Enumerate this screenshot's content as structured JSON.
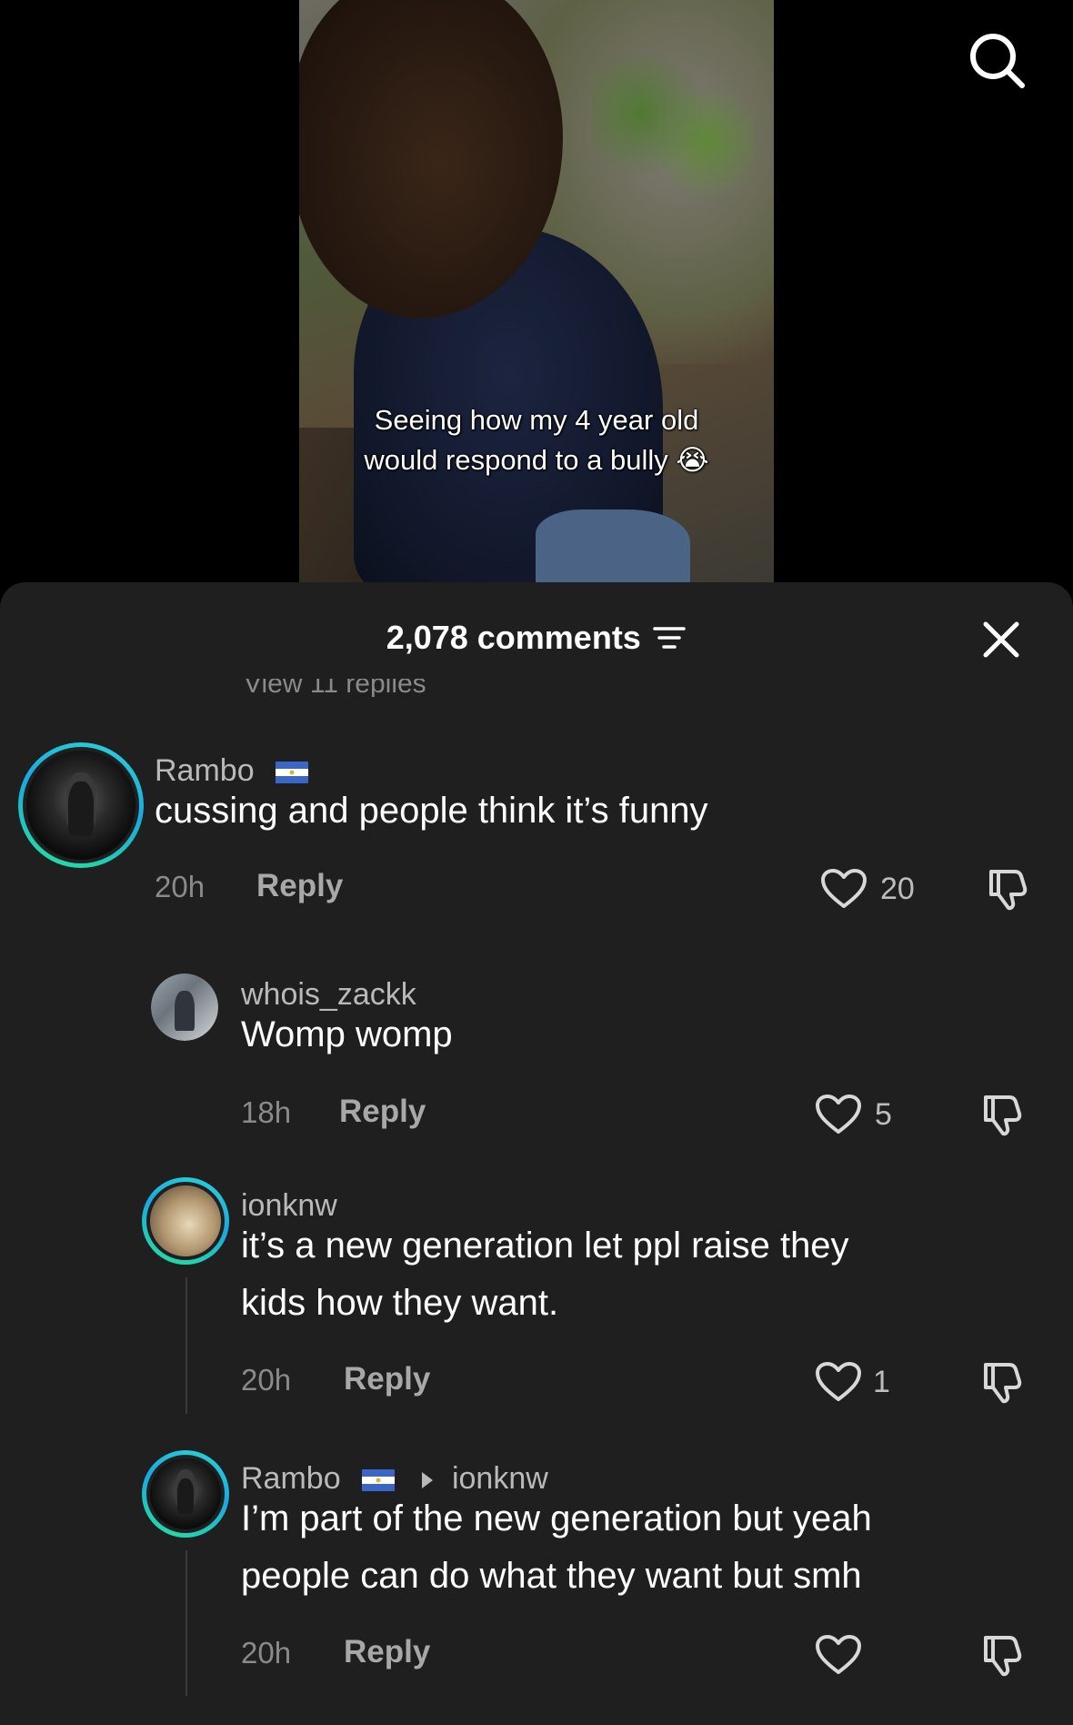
{
  "video": {
    "caption_line1": "Seeing how my 4 year old",
    "caption_line2": "would respond to a bully 😭"
  },
  "header": {
    "comment_count": "2,078 comments"
  },
  "view_replies_text": "View 11 replies",
  "comments": [
    {
      "username": "Rambo",
      "flag": "Nicaragua",
      "text": "cussing and people think it’s funny",
      "time": "20h",
      "reply_label": "Reply",
      "likes": "20"
    },
    {
      "username": "whois_zackk",
      "text": "Womp womp",
      "time": "18h",
      "reply_label": "Reply",
      "likes": "5"
    },
    {
      "username": "ionknw",
      "text_line1": "it’s a new generation let ppl raise they",
      "text_line2": "kids how they want.",
      "time": "20h",
      "reply_label": "Reply",
      "likes": "1"
    },
    {
      "username": "Rambo",
      "flag": "Nicaragua",
      "reply_to": "ionknw",
      "text_line1": "I’m part of the new generation but yeah",
      "text_line2": "people can do what they want but smh",
      "time": "20h",
      "reply_label": "Reply",
      "likes": ""
    }
  ],
  "colors": {
    "sheet_bg": "#1f1f1f",
    "ring_gradient_start": "#2bd6d3",
    "ring_gradient_end": "#27e29a",
    "muted_text": "#8a8a8a"
  },
  "icons": [
    "search-icon",
    "filter-icon",
    "close-icon",
    "heart-icon",
    "dislike-icon",
    "flag-icon",
    "reply-arrow-icon"
  ]
}
